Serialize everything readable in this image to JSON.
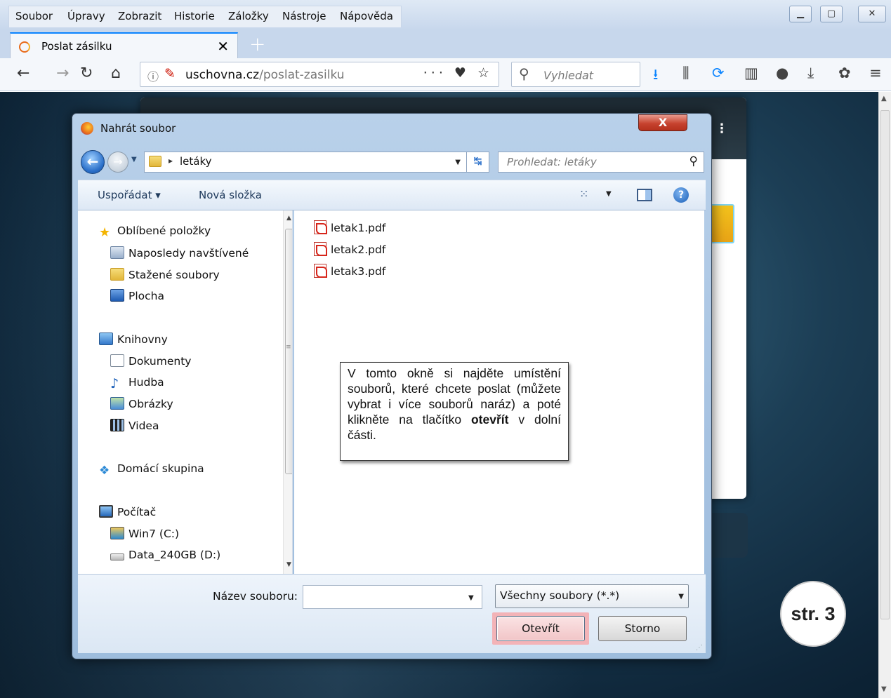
{
  "browser": {
    "menu": [
      "Soubor",
      "Úpravy",
      "Zobrazit",
      "Historie",
      "Záložky",
      "Nástroje",
      "Nápověda"
    ],
    "window_controls": [
      "minimize",
      "maximize",
      "close"
    ],
    "tab": {
      "title": "Poslat zásilku",
      "close": "✕"
    },
    "new_tab": "+",
    "url": {
      "domain": "uschovna.cz",
      "path": "/poslat-zasilku",
      "actions": "··· ♥ ☆"
    },
    "search_placeholder": "Vyhledat",
    "toolbar_icons": [
      "download-arrow-icon",
      "library-icon",
      "sync-icon",
      "sidebar-icon",
      "extension-icon",
      "download-icon",
      "addon-icon",
      "menu-icon"
    ]
  },
  "page": {
    "page_badge": "str. 3",
    "panel_menu": "⋮"
  },
  "dialog": {
    "title": "Nahrát soubor",
    "close": "X",
    "path": {
      "crumb": "letáky"
    },
    "search_placeholder": "Prohledat: letáky",
    "toolbar": {
      "organize": "Uspořádat ▾",
      "new_folder": "Nová složka"
    },
    "nav": {
      "favorites": "Oblíbené položky",
      "recent": "Naposledy navštívené",
      "downloads": "Stažené soubory",
      "desktop": "Plocha",
      "libraries": "Knihovny",
      "documents": "Dokumenty",
      "music": "Hudba",
      "pictures": "Obrázky",
      "videos": "Videa",
      "homegroup": "Domácí skupina",
      "computer": "Počítač",
      "drive_c": "Win7 (C:)",
      "drive_d": "Data_240GB (D:)"
    },
    "files": [
      "letak1.pdf",
      "letak2.pdf",
      "letak3.pdf"
    ],
    "filename_label": "Název souboru:",
    "filename_value": "",
    "filter": "Všechny soubory (*.*)",
    "open_label": "Otevřít",
    "cancel_label": "Storno"
  },
  "callout": {
    "text_before": "V tomto okně si najděte umístění souborů, které chcete poslat (můžete vybrat i více souborů naráz) a poté klikněte na tlačítko ",
    "bold": "otevřít",
    "text_after": " v dolní části."
  },
  "colors": {
    "accent_tab": "#0a84ff",
    "open_highlight": "#f3b3b7",
    "close_red": "#c7432f"
  }
}
